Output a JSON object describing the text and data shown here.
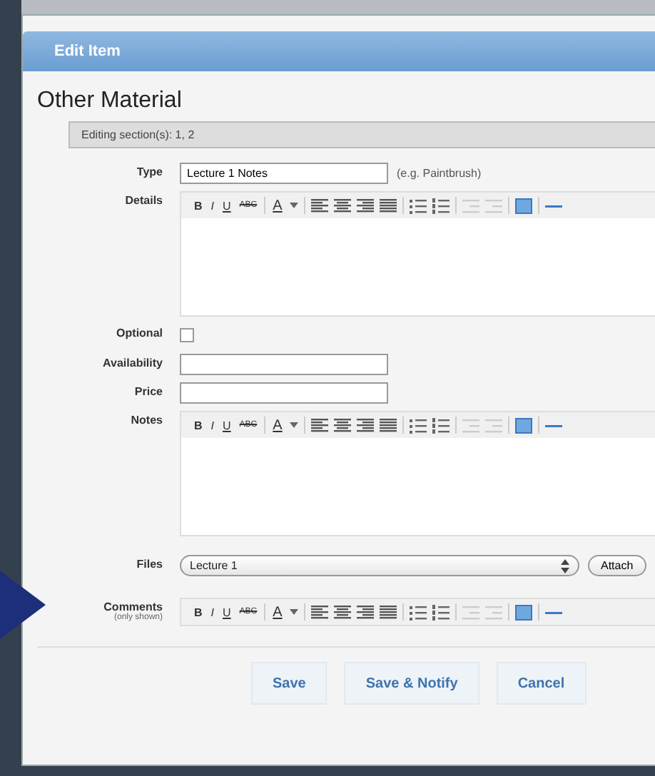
{
  "dialog": {
    "title": "Edit Item"
  },
  "heading": "Other Material",
  "section_bar": "Editing section(s): 1, 2",
  "fields": [
    {
      "kind": "text",
      "label": "Type",
      "value": "Lecture 1 Notes",
      "hint": "(e.g. Paintbrush)"
    },
    {
      "kind": "editor",
      "label": "Details",
      "toolbar": [
        "B",
        "I",
        "U",
        "ABC",
        "A"
      ]
    },
    {
      "kind": "checkbox",
      "label": "Optional",
      "checked": false
    },
    {
      "kind": "text",
      "label": "Availability"
    },
    {
      "kind": "text",
      "label": "Price"
    },
    {
      "kind": "editor",
      "label": "Notes",
      "toolbar": [
        "B",
        "I",
        "U",
        "ABC",
        "A"
      ]
    },
    {
      "kind": "select",
      "label": "Files",
      "value": "Lecture 1",
      "button": "Attach"
    },
    {
      "kind": "toolbar",
      "label": "Comments",
      "sublabel": "(only shown)",
      "toolbar": [
        "B",
        "I",
        "U",
        "ABC",
        "A"
      ]
    }
  ],
  "buttons": [
    "Save",
    "Save & Notify",
    "Cancel"
  ]
}
